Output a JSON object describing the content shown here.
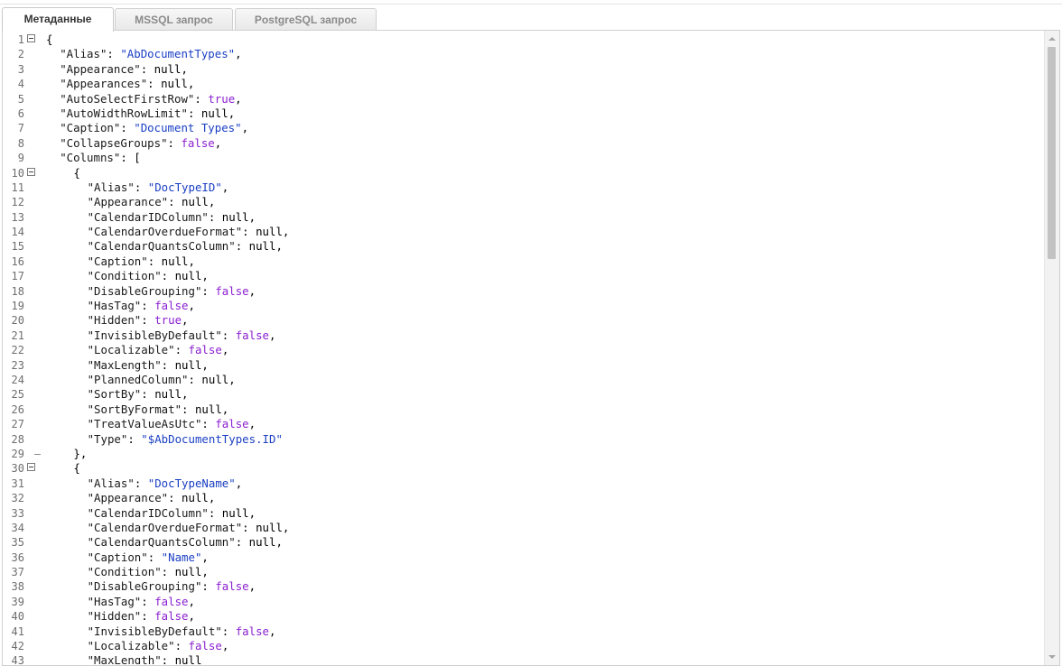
{
  "tabs": [
    {
      "label": "Метаданные",
      "active": true
    },
    {
      "label": "MSSQL запрос",
      "active": false
    },
    {
      "label": "PostgreSQL запрос",
      "active": false
    }
  ],
  "colors": {
    "string": "#1a3fc4",
    "keyword": "#8a1fd1",
    "line_number": "#6e6e6e"
  },
  "editor": {
    "lines": [
      {
        "n": "1",
        "fold": "open",
        "indent": 0,
        "tokens": [
          [
            "p",
            "{"
          ]
        ]
      },
      {
        "n": "2",
        "indent": 2,
        "tokens": [
          [
            "k",
            "\"Alias\""
          ],
          [
            "p",
            ": "
          ],
          [
            "s",
            "\"AbDocumentTypes\""
          ],
          [
            "p",
            ","
          ]
        ]
      },
      {
        "n": "3",
        "indent": 2,
        "tokens": [
          [
            "k",
            "\"Appearance\""
          ],
          [
            "p",
            ": null,"
          ]
        ]
      },
      {
        "n": "4",
        "indent": 2,
        "tokens": [
          [
            "k",
            "\"Appearances\""
          ],
          [
            "p",
            ": null,"
          ]
        ]
      },
      {
        "n": "5",
        "indent": 2,
        "tokens": [
          [
            "k",
            "\"AutoSelectFirstRow\""
          ],
          [
            "p",
            ": "
          ],
          [
            "b",
            "true"
          ],
          [
            "p",
            ","
          ]
        ]
      },
      {
        "n": "6",
        "indent": 2,
        "tokens": [
          [
            "k",
            "\"AutoWidthRowLimit\""
          ],
          [
            "p",
            ": null,"
          ]
        ]
      },
      {
        "n": "7",
        "indent": 2,
        "tokens": [
          [
            "k",
            "\"Caption\""
          ],
          [
            "p",
            ": "
          ],
          [
            "s",
            "\"Document Types\""
          ],
          [
            "p",
            ","
          ]
        ]
      },
      {
        "n": "8",
        "indent": 2,
        "tokens": [
          [
            "k",
            "\"CollapseGroups\""
          ],
          [
            "p",
            ": "
          ],
          [
            "b",
            "false"
          ],
          [
            "p",
            ","
          ]
        ]
      },
      {
        "n": "9",
        "indent": 2,
        "tokens": [
          [
            "k",
            "\"Columns\""
          ],
          [
            "p",
            ": ["
          ]
        ]
      },
      {
        "n": "10",
        "fold": "open",
        "indent": 4,
        "tokens": [
          [
            "p",
            "{"
          ]
        ]
      },
      {
        "n": "11",
        "indent": 6,
        "tokens": [
          [
            "k",
            "\"Alias\""
          ],
          [
            "p",
            ": "
          ],
          [
            "s",
            "\"DocTypeID\""
          ],
          [
            "p",
            ","
          ]
        ]
      },
      {
        "n": "12",
        "indent": 6,
        "tokens": [
          [
            "k",
            "\"Appearance\""
          ],
          [
            "p",
            ": null,"
          ]
        ]
      },
      {
        "n": "13",
        "indent": 6,
        "tokens": [
          [
            "k",
            "\"CalendarIDColumn\""
          ],
          [
            "p",
            ": null,"
          ]
        ]
      },
      {
        "n": "14",
        "indent": 6,
        "tokens": [
          [
            "k",
            "\"CalendarOverdueFormat\""
          ],
          [
            "p",
            ": null,"
          ]
        ]
      },
      {
        "n": "15",
        "indent": 6,
        "tokens": [
          [
            "k",
            "\"CalendarQuantsColumn\""
          ],
          [
            "p",
            ": null,"
          ]
        ]
      },
      {
        "n": "16",
        "indent": 6,
        "tokens": [
          [
            "k",
            "\"Caption\""
          ],
          [
            "p",
            ": null,"
          ]
        ]
      },
      {
        "n": "17",
        "indent": 6,
        "tokens": [
          [
            "k",
            "\"Condition\""
          ],
          [
            "p",
            ": null,"
          ]
        ]
      },
      {
        "n": "18",
        "indent": 6,
        "tokens": [
          [
            "k",
            "\"DisableGrouping\""
          ],
          [
            "p",
            ": "
          ],
          [
            "b",
            "false"
          ],
          [
            "p",
            ","
          ]
        ]
      },
      {
        "n": "19",
        "indent": 6,
        "tokens": [
          [
            "k",
            "\"HasTag\""
          ],
          [
            "p",
            ": "
          ],
          [
            "b",
            "false"
          ],
          [
            "p",
            ","
          ]
        ]
      },
      {
        "n": "20",
        "indent": 6,
        "tokens": [
          [
            "k",
            "\"Hidden\""
          ],
          [
            "p",
            ": "
          ],
          [
            "b",
            "true"
          ],
          [
            "p",
            ","
          ]
        ]
      },
      {
        "n": "21",
        "indent": 6,
        "tokens": [
          [
            "k",
            "\"InvisibleByDefault\""
          ],
          [
            "p",
            ": "
          ],
          [
            "b",
            "false"
          ],
          [
            "p",
            ","
          ]
        ]
      },
      {
        "n": "22",
        "indent": 6,
        "tokens": [
          [
            "k",
            "\"Localizable\""
          ],
          [
            "p",
            ": "
          ],
          [
            "b",
            "false"
          ],
          [
            "p",
            ","
          ]
        ]
      },
      {
        "n": "23",
        "indent": 6,
        "tokens": [
          [
            "k",
            "\"MaxLength\""
          ],
          [
            "p",
            ": null,"
          ]
        ]
      },
      {
        "n": "24",
        "indent": 6,
        "tokens": [
          [
            "k",
            "\"PlannedColumn\""
          ],
          [
            "p",
            ": null,"
          ]
        ]
      },
      {
        "n": "25",
        "indent": 6,
        "tokens": [
          [
            "k",
            "\"SortBy\""
          ],
          [
            "p",
            ": null,"
          ]
        ]
      },
      {
        "n": "26",
        "indent": 6,
        "tokens": [
          [
            "k",
            "\"SortByFormat\""
          ],
          [
            "p",
            ": null,"
          ]
        ]
      },
      {
        "n": "27",
        "indent": 6,
        "tokens": [
          [
            "k",
            "\"TreatValueAsUtc\""
          ],
          [
            "p",
            ": "
          ],
          [
            "b",
            "false"
          ],
          [
            "p",
            ","
          ]
        ]
      },
      {
        "n": "28",
        "indent": 6,
        "tokens": [
          [
            "k",
            "\"Type\""
          ],
          [
            "p",
            ": "
          ],
          [
            "s",
            "\"$AbDocumentTypes.ID\""
          ]
        ]
      },
      {
        "n": "29",
        "fold": "end",
        "indent": 4,
        "tokens": [
          [
            "p",
            "},"
          ]
        ]
      },
      {
        "n": "30",
        "fold": "open",
        "indent": 4,
        "tokens": [
          [
            "p",
            "{"
          ]
        ]
      },
      {
        "n": "31",
        "indent": 6,
        "tokens": [
          [
            "k",
            "\"Alias\""
          ],
          [
            "p",
            ": "
          ],
          [
            "s",
            "\"DocTypeName\""
          ],
          [
            "p",
            ","
          ]
        ]
      },
      {
        "n": "32",
        "indent": 6,
        "tokens": [
          [
            "k",
            "\"Appearance\""
          ],
          [
            "p",
            ": null,"
          ]
        ]
      },
      {
        "n": "33",
        "indent": 6,
        "tokens": [
          [
            "k",
            "\"CalendarIDColumn\""
          ],
          [
            "p",
            ": null,"
          ]
        ]
      },
      {
        "n": "34",
        "indent": 6,
        "tokens": [
          [
            "k",
            "\"CalendarOverdueFormat\""
          ],
          [
            "p",
            ": null,"
          ]
        ]
      },
      {
        "n": "35",
        "indent": 6,
        "tokens": [
          [
            "k",
            "\"CalendarQuantsColumn\""
          ],
          [
            "p",
            ": null,"
          ]
        ]
      },
      {
        "n": "36",
        "indent": 6,
        "tokens": [
          [
            "k",
            "\"Caption\""
          ],
          [
            "p",
            ": "
          ],
          [
            "s",
            "\"Name\""
          ],
          [
            "p",
            ","
          ]
        ]
      },
      {
        "n": "37",
        "indent": 6,
        "tokens": [
          [
            "k",
            "\"Condition\""
          ],
          [
            "p",
            ": null,"
          ]
        ]
      },
      {
        "n": "38",
        "indent": 6,
        "tokens": [
          [
            "k",
            "\"DisableGrouping\""
          ],
          [
            "p",
            ": "
          ],
          [
            "b",
            "false"
          ],
          [
            "p",
            ","
          ]
        ]
      },
      {
        "n": "39",
        "indent": 6,
        "tokens": [
          [
            "k",
            "\"HasTag\""
          ],
          [
            "p",
            ": "
          ],
          [
            "b",
            "false"
          ],
          [
            "p",
            ","
          ]
        ]
      },
      {
        "n": "40",
        "indent": 6,
        "tokens": [
          [
            "k",
            "\"Hidden\""
          ],
          [
            "p",
            ": "
          ],
          [
            "b",
            "false"
          ],
          [
            "p",
            ","
          ]
        ]
      },
      {
        "n": "41",
        "indent": 6,
        "tokens": [
          [
            "k",
            "\"InvisibleByDefault\""
          ],
          [
            "p",
            ": "
          ],
          [
            "b",
            "false"
          ],
          [
            "p",
            ","
          ]
        ]
      },
      {
        "n": "42",
        "indent": 6,
        "tokens": [
          [
            "k",
            "\"Localizable\""
          ],
          [
            "p",
            ": "
          ],
          [
            "b",
            "false"
          ],
          [
            "p",
            ","
          ]
        ]
      },
      {
        "n": "43",
        "indent": 6,
        "tokens": [
          [
            "k",
            "\"MaxLength\""
          ],
          [
            "p",
            ": null"
          ]
        ]
      }
    ]
  }
}
